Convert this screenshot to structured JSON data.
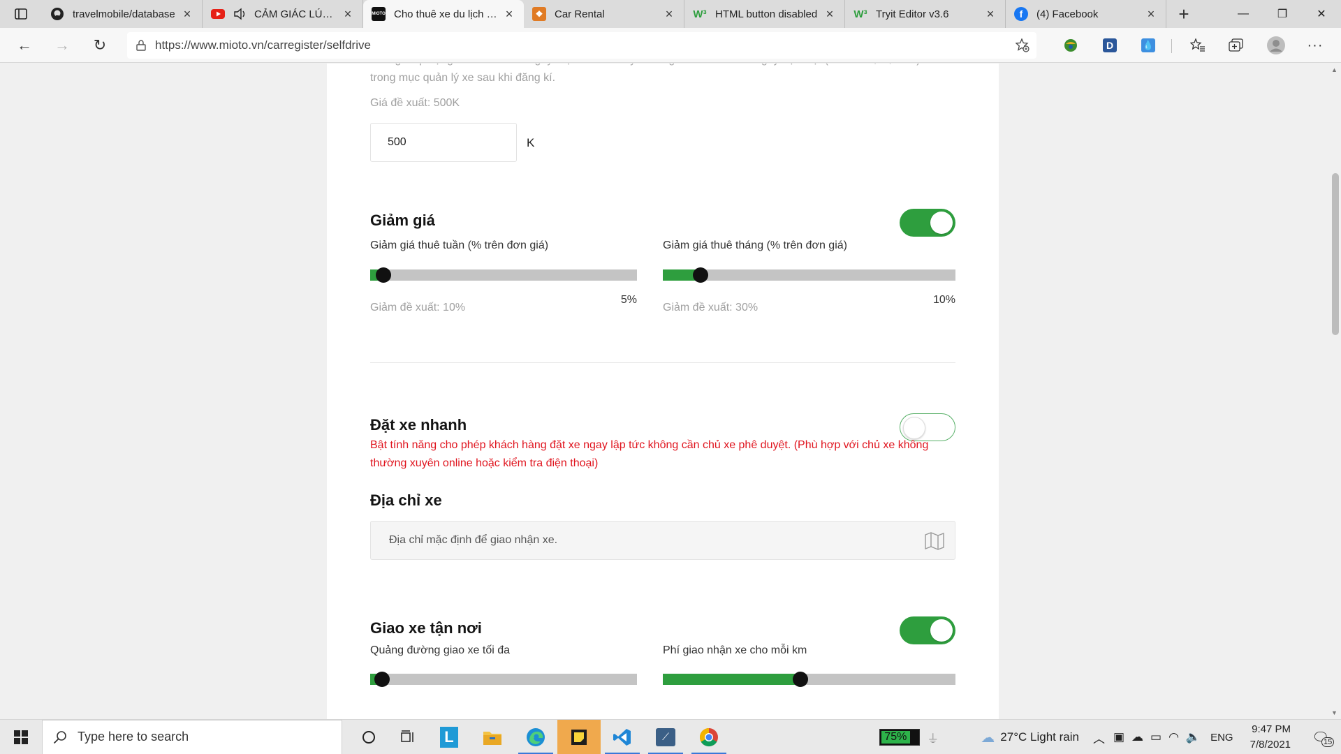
{
  "browser": {
    "tabs": [
      {
        "label": "travelmobile/database",
        "icon": "github-icon",
        "active": false
      },
      {
        "label": "CẢM GIÁC LÚC ẤY",
        "icon": "youtube-icon",
        "audio": true,
        "active": false
      },
      {
        "label": "Cho thuê xe du lịch - C",
        "icon": "mioto-icon",
        "active": true
      },
      {
        "label": "Car Rental",
        "icon": "code-icon",
        "active": false
      },
      {
        "label": "HTML button disabled",
        "icon": "w3-icon",
        "active": false
      },
      {
        "label": "Tryit Editor v3.6",
        "icon": "w3-icon",
        "active": false
      },
      {
        "label": "(4) Facebook",
        "icon": "facebook-icon",
        "active": false
      }
    ],
    "url": "https://www.mioto.vn/carregister/selfdrive"
  },
  "page": {
    "top_note_line1": "Đơn giá áp dụng cho tất cả các ngày. Bạn có thuể tuỳ chỉnh giá khác cho các ngày đặc biệt (cuối tuần, lễ, tết...)",
    "top_note_line2": "trong mục quản lý xe sau khi đăng kí.",
    "price_suggest": "Giá đề xuất: 500K",
    "price_value": "500",
    "price_unit": "K",
    "discount": {
      "title": "Giảm giá",
      "enabled": true,
      "weekly_label": "Giảm giá thuê tuần (% trên đơn giá)",
      "weekly_value": "5%",
      "weekly_fraction": 0.05,
      "weekly_suggest": "Giảm đề xuất: 10%",
      "monthly_label": "Giảm giá thuê tháng (% trên đơn giá)",
      "monthly_value": "10%",
      "monthly_fraction": 0.13,
      "monthly_suggest": "Giảm đề xuất: 30%"
    },
    "quick_booking": {
      "title": "Đặt xe nhanh",
      "enabled": false,
      "desc_line1": "Bật tính năng cho phép khách hàng đặt xe ngay lập tức không cần chủ xe phê duyệt. (Phù hợp với chủ xe không",
      "desc_line2": "thường xuyên online hoặc kiểm tra điện thoại)"
    },
    "address": {
      "title": "Địa chỉ xe",
      "placeholder": "Địa chỉ mặc định để giao nhận xe."
    },
    "delivery": {
      "title": "Giao xe tận nơi",
      "enabled": true,
      "distance_label": "Quảng đường giao xe tối đa",
      "distance_fraction": 0.045,
      "fee_label": "Phí giao nhận xe cho mỗi km",
      "fee_fraction": 0.47
    }
  },
  "taskbar": {
    "search_placeholder": "Type here to search",
    "battery": "75%",
    "weather": "27°C  Light rain",
    "language": "ENG",
    "time": "9:47 PM",
    "date": "7/8/2021",
    "notifications": "15"
  },
  "colors": {
    "green": "#2e9e3e",
    "red": "#e0141e",
    "muted": "#a0a0a0"
  }
}
